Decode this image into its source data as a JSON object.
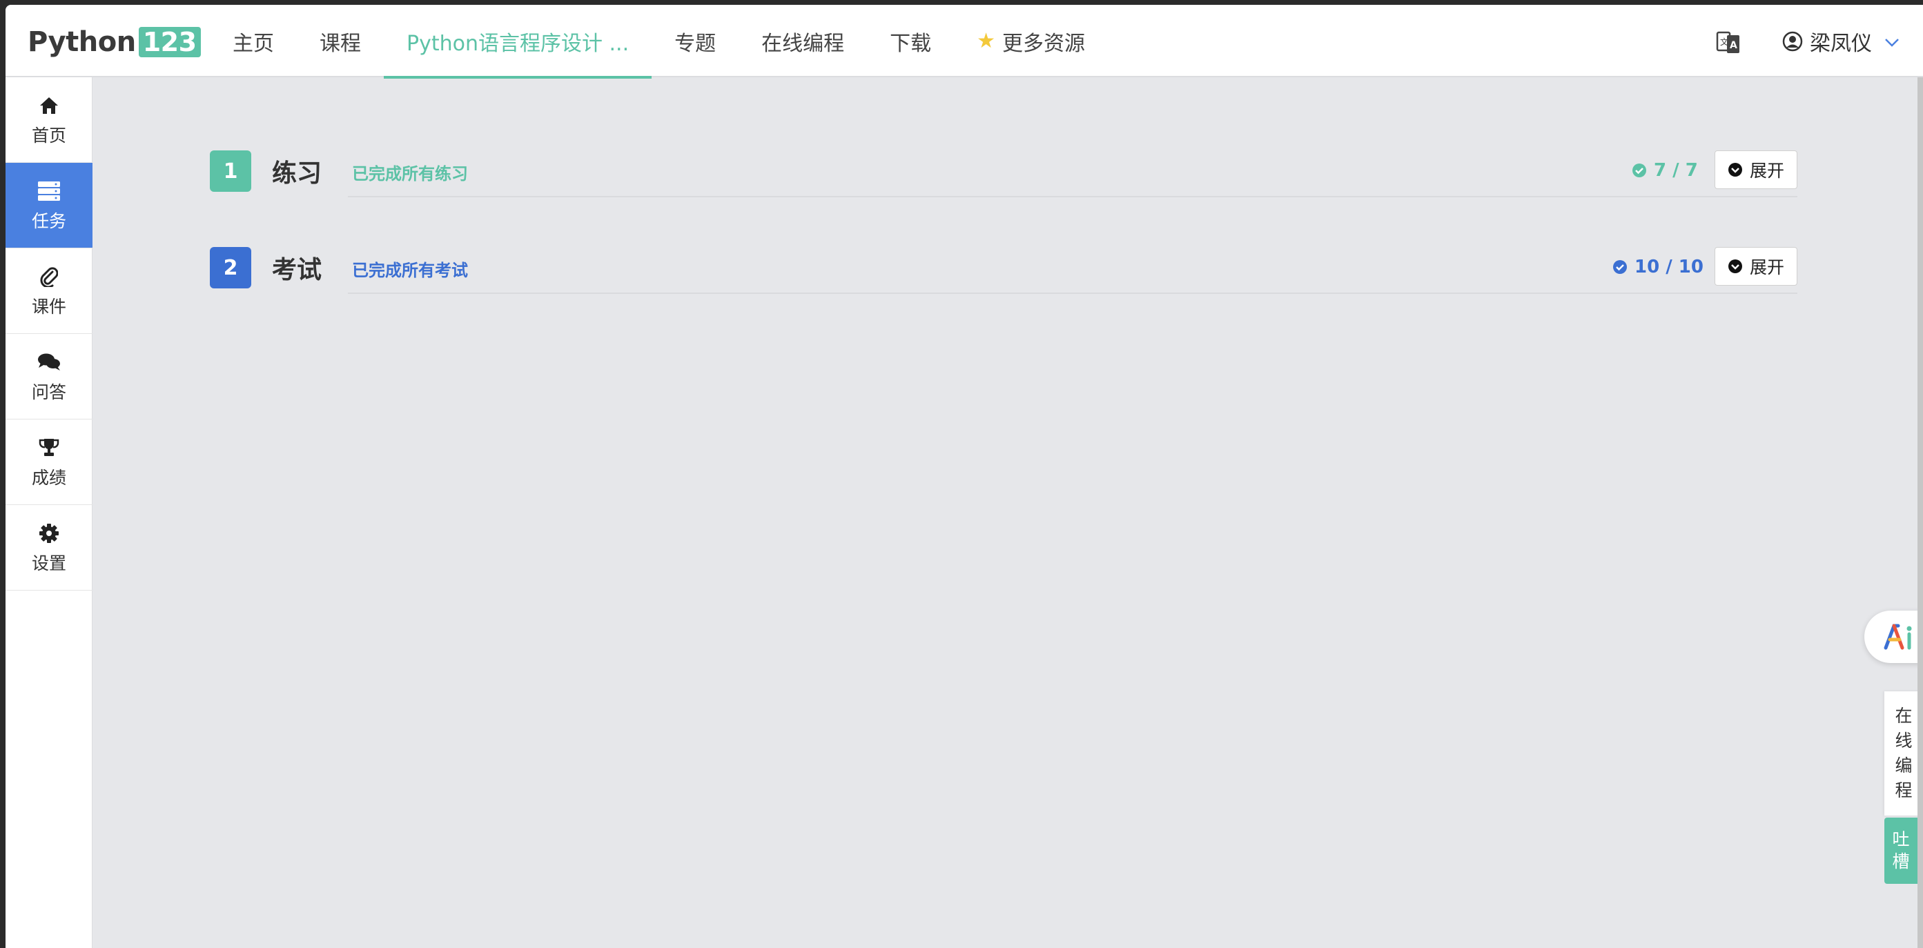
{
  "header": {
    "logo_text": "Python",
    "logo_num": "123",
    "nav": [
      {
        "label": "主页"
      },
      {
        "label": "课程"
      },
      {
        "label": "Python语言程序设计 ..."
      },
      {
        "label": "专题"
      },
      {
        "label": "在线编程"
      },
      {
        "label": "下载"
      },
      {
        "label": "更多资源",
        "icon": "star-icon"
      }
    ],
    "active_nav_index": 2,
    "user_name": "梁凤仪"
  },
  "sidebar": {
    "items": [
      {
        "label": "首页",
        "icon": "home-icon"
      },
      {
        "label": "任务",
        "icon": "tasks-icon"
      },
      {
        "label": "课件",
        "icon": "paperclip-icon"
      },
      {
        "label": "问答",
        "icon": "comments-icon"
      },
      {
        "label": "成绩",
        "icon": "trophy-icon"
      },
      {
        "label": "设置",
        "icon": "gear-icon"
      }
    ],
    "active_index": 1
  },
  "sections": [
    {
      "number": "1",
      "title": "练习",
      "status": "已完成所有练习",
      "count": "7 / 7",
      "button": "展开",
      "color": "#5cc2a6"
    },
    {
      "number": "2",
      "title": "考试",
      "status": "已完成所有考试",
      "count": "10 / 10",
      "button": "展开",
      "color": "#3b6fd2"
    }
  ],
  "floating": {
    "online_label": [
      "在",
      "线",
      "编",
      "程"
    ],
    "feedback_label": [
      "吐",
      "槽"
    ]
  },
  "colors": {
    "accent_green": "#5cc2a6",
    "accent_blue": "#4a80e0",
    "background": "#e6e7ea"
  }
}
